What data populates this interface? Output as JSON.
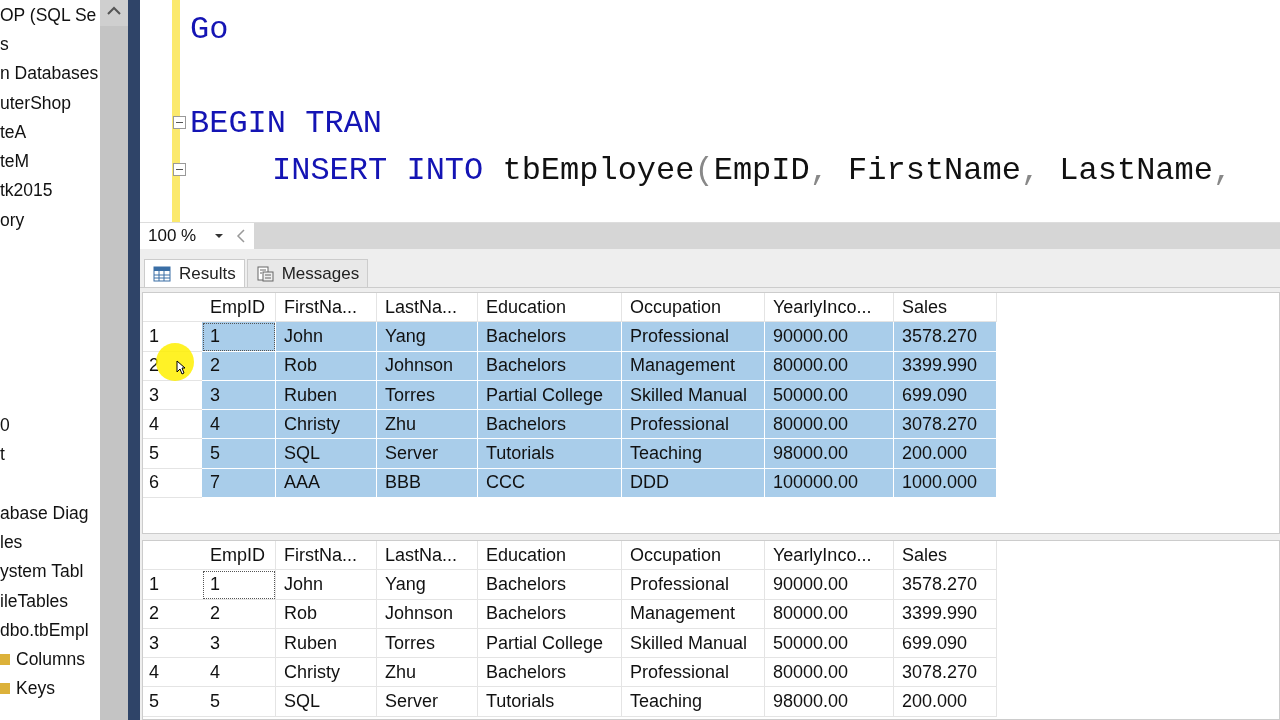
{
  "tree": {
    "groups": [
      [
        "OP (SQL Se",
        "s",
        "n Databases",
        "uterShop",
        "teA",
        "teM",
        "tk2015",
        "ory"
      ],
      [
        "0",
        "t"
      ],
      [
        "abase Diag",
        "les",
        "ystem Tabl",
        "ileTables",
        "dbo.tbEmpl"
      ],
      [
        {
          "text": "Columns",
          "kind": "folder"
        },
        {
          "text": "Keys",
          "kind": "folder"
        }
      ]
    ]
  },
  "editor": {
    "lines": [
      {
        "fold": false,
        "indent": false,
        "blank_before": false,
        "tokens": [
          {
            "kind": "keyword",
            "text": "Go"
          }
        ]
      },
      {
        "fold": true,
        "indent": false,
        "blank_before": true,
        "tokens": [
          {
            "kind": "keyword",
            "text": "BEGIN TRAN"
          }
        ]
      },
      {
        "fold": true,
        "indent": true,
        "blank_before": false,
        "tokens": [
          {
            "kind": "keyword",
            "text": "INSERT INTO "
          },
          {
            "kind": "plain",
            "text": "tbEmployee"
          },
          {
            "kind": "punct",
            "text": "("
          },
          {
            "kind": "plain",
            "text": "EmpID"
          },
          {
            "kind": "punct",
            "text": ", "
          },
          {
            "kind": "plain",
            "text": "FirstName"
          },
          {
            "kind": "punct",
            "text": ", "
          },
          {
            "kind": "plain",
            "text": "LastName"
          },
          {
            "kind": "punct",
            "text": ","
          }
        ]
      }
    ]
  },
  "zoom": {
    "value": "100 %"
  },
  "tabs": [
    {
      "label": "Results",
      "selected": true,
      "kind": "grid"
    },
    {
      "label": "Messages",
      "selected": false,
      "kind": "messages"
    }
  ],
  "grids": [
    {
      "columns": [
        "EmpID",
        "FirstNa...",
        "LastNa...",
        "Education",
        "Occupation",
        "YearlyInco...",
        "Sales"
      ],
      "rows": [
        {
          "num": "1",
          "selected": true,
          "cells": [
            "1",
            "John",
            "Yang",
            "Bachelors",
            "Professional",
            "90000.00",
            "3578.270"
          ]
        },
        {
          "num": "2",
          "selected": true,
          "cells": [
            "2",
            "Rob",
            "Johnson",
            "Bachelors",
            "Management",
            "80000.00",
            "3399.990"
          ]
        },
        {
          "num": "3",
          "selected": true,
          "cells": [
            "3",
            "Ruben",
            "Torres",
            "Partial College",
            "Skilled Manual",
            "50000.00",
            "699.090"
          ]
        },
        {
          "num": "4",
          "selected": true,
          "cells": [
            "4",
            "Christy",
            "Zhu",
            "Bachelors",
            "Professional",
            "80000.00",
            "3078.270"
          ]
        },
        {
          "num": "5",
          "selected": true,
          "cells": [
            "5",
            "SQL",
            "Server",
            "Tutorials",
            "Teaching",
            "98000.00",
            "200.000"
          ]
        },
        {
          "num": "6",
          "selected": true,
          "cells": [
            "7",
            "AAA",
            "BBB",
            "CCC",
            "DDD",
            "100000.00",
            "1000.000"
          ]
        }
      ]
    },
    {
      "columns": [
        "EmpID",
        "FirstNa...",
        "LastNa...",
        "Education",
        "Occupation",
        "YearlyInco...",
        "Sales"
      ],
      "rows": [
        {
          "num": "1",
          "selected": false,
          "cells": [
            "1",
            "John",
            "Yang",
            "Bachelors",
            "Professional",
            "90000.00",
            "3578.270"
          ]
        },
        {
          "num": "2",
          "selected": false,
          "cells": [
            "2",
            "Rob",
            "Johnson",
            "Bachelors",
            "Management",
            "80000.00",
            "3399.990"
          ]
        },
        {
          "num": "3",
          "selected": false,
          "cells": [
            "3",
            "Ruben",
            "Torres",
            "Partial College",
            "Skilled Manual",
            "50000.00",
            "699.090"
          ]
        },
        {
          "num": "4",
          "selected": false,
          "cells": [
            "4",
            "Christy",
            "Zhu",
            "Bachelors",
            "Professional",
            "80000.00",
            "3078.270"
          ]
        },
        {
          "num": "5",
          "selected": false,
          "cells": [
            "5",
            "SQL",
            "Server",
            "Tutorials",
            "Teaching",
            "98000.00",
            "200.000"
          ]
        }
      ]
    }
  ]
}
